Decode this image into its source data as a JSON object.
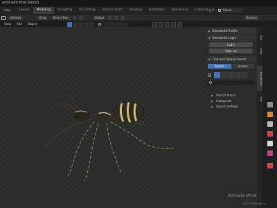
{
  "window": {
    "title": "ant2-edit-final.blend]"
  },
  "menubar": {
    "items": [
      "Help",
      "Layout",
      "Modeling",
      "Sculpting",
      "UV Editing",
      "Texture Paint",
      "Shading",
      "Animation",
      "Rendering",
      "Compositing",
      "Scripting"
    ],
    "active": "Modeling",
    "scene_label": "Scene"
  },
  "toolbar": {
    "mode": "Default",
    "drag_label": "Drag",
    "select_label": "Select Box",
    "transform_label": "Global",
    "options_label": "Options"
  },
  "viewport": {
    "menus": [
      "View",
      "Add",
      "Object"
    ]
  },
  "npanel": {
    "panel1": "BlenderKit Profile",
    "panel2": "BlenderKit Login",
    "login_button": "Login",
    "signup_button": "Sign up",
    "panel3": "Find and Upload Assets",
    "tab_search": "Search",
    "tab_upload": "Upload",
    "sub1": "Search filters",
    "sub2": "Categories",
    "sub3": "Import settings"
  },
  "vtabs": [
    "Tool",
    "View",
    "BlenderKit",
    "Edit"
  ],
  "watermark": {
    "line1": "Activate Wind",
    "line2": "Go to Settings to"
  },
  "colors": {
    "accent": "#4772b3",
    "ant_body": "#2e2b20",
    "ant_stripe": "#c9b77a"
  }
}
